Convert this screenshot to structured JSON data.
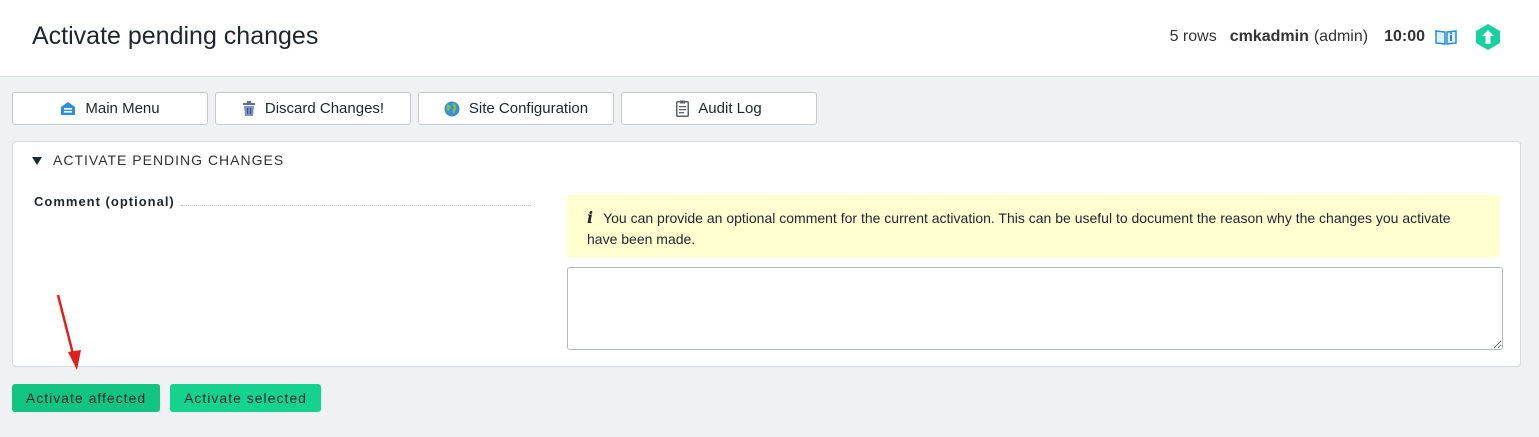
{
  "header": {
    "title": "Activate pending changes",
    "rows": "5 rows",
    "user": "cmkadmin",
    "role": "(admin)",
    "time": "10:00",
    "book_icon": "book-icon",
    "logo_icon": "checkmk-logo-icon"
  },
  "toolbar": {
    "buttons": [
      {
        "label": "Main Menu",
        "icon": "main-menu-icon"
      },
      {
        "label": "Discard Changes!",
        "icon": "trash-icon"
      },
      {
        "label": "Site Configuration",
        "icon": "globe-icon"
      },
      {
        "label": "Audit Log",
        "icon": "clipboard-icon"
      }
    ]
  },
  "section": {
    "title": "ACTIVATE PENDING CHANGES",
    "comment_label": "Comment (optional)",
    "info_icon": "i",
    "info_text": "You can provide an optional comment for the current activation. This can be useful to document the reason why the changes you activate have been made.",
    "comment_value": ""
  },
  "actions": {
    "activate_affected": "Activate affected",
    "activate_selected": "Activate selected"
  },
  "colors": {
    "accent_green": "#13d38e",
    "info_background": "#ffffd0",
    "annotation_arrow": "#e0201b"
  }
}
